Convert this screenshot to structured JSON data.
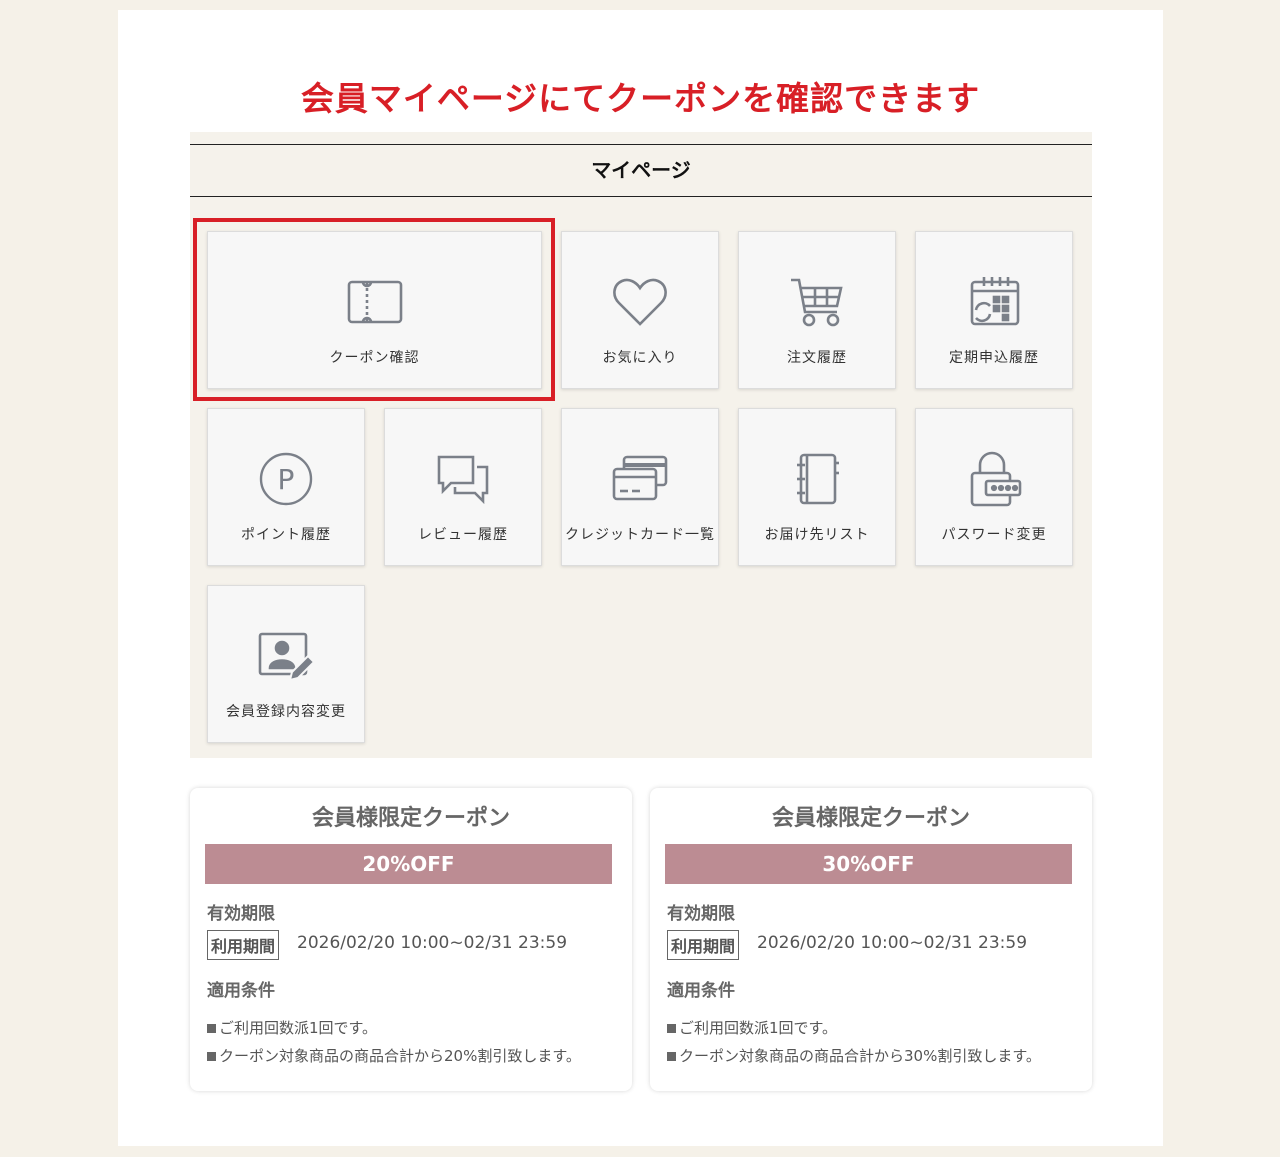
{
  "headline": "会員マイページにてクーポンを確認できます",
  "mypage": {
    "title": "マイページ",
    "tiles": [
      {
        "label": "クーポン確認",
        "icon": "coupon-ticket-icon",
        "highlighted": true
      },
      {
        "label": "お気に入り",
        "icon": "heart-icon"
      },
      {
        "label": "注文履歴",
        "icon": "shopping-cart-icon"
      },
      {
        "label": "定期申込履歴",
        "icon": "calendar-refresh-icon"
      },
      {
        "label": "ポイント履歴",
        "icon": "point-circle-icon"
      },
      {
        "label": "レビュー履歴",
        "icon": "chat-bubbles-icon"
      },
      {
        "label": "クレジットカード一覧",
        "icon": "credit-card-icon"
      },
      {
        "label": "お届け先リスト",
        "icon": "address-book-icon"
      },
      {
        "label": "パスワード変更",
        "icon": "padlock-password-icon"
      },
      {
        "label": "会員登録内容変更",
        "icon": "profile-edit-icon"
      }
    ]
  },
  "coupons": [
    {
      "title": "会員様限定クーポン",
      "discount": "20%OFF",
      "validity_heading": "有効期限",
      "period_tag": "利用期間",
      "period": "2026/02/20 10:00~02/31 23:59",
      "conditions_heading": "適用条件",
      "conditions": [
        "ご利用回数派1回です。",
        "クーポン対象商品の商品合計から20%割引致します。"
      ]
    },
    {
      "title": "会員様限定クーポン",
      "discount": "30%OFF",
      "validity_heading": "有効期限",
      "period_tag": "利用期間",
      "period": "2026/02/20 10:00~02/31 23:59",
      "conditions_heading": "適用条件",
      "conditions": [
        "ご利用回数派1回です。",
        "クーポン対象商品の商品合計から30%割引致します。"
      ]
    }
  ],
  "colors": {
    "accent_red": "#d81f26",
    "coupon_band": "#bc8c93",
    "page_bg": "#f5f1e8",
    "icon_gray": "#7b8089"
  }
}
